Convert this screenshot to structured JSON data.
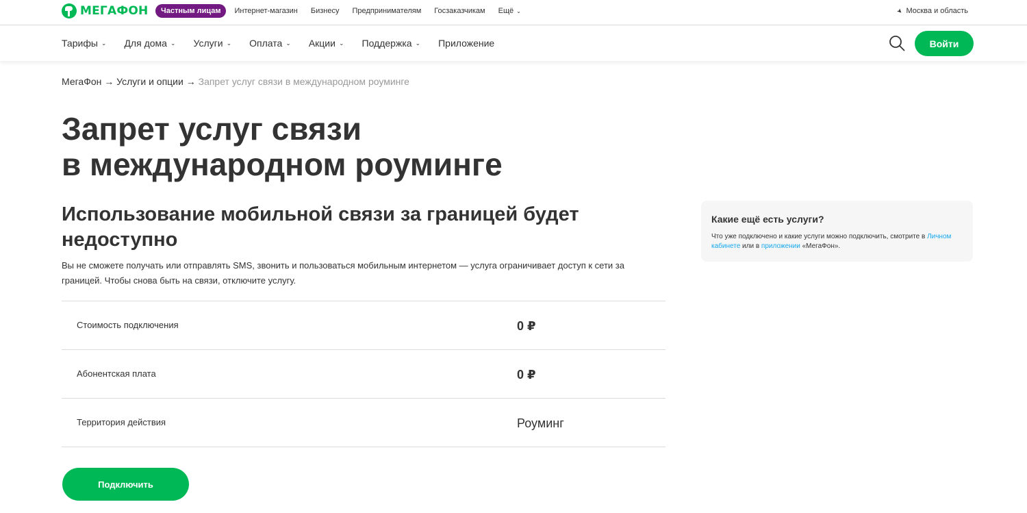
{
  "brand": {
    "logo_text": "МЕГАФОН",
    "accent": "#00b956",
    "segment_accent": "#731982"
  },
  "top_segments": [
    {
      "label": "Частным лицам",
      "active": true
    },
    {
      "label": "Интернет-магазин"
    },
    {
      "label": "Бизнесу"
    },
    {
      "label": "Предпринимателям"
    },
    {
      "label": "Госзаказчикам"
    },
    {
      "label": "Ещё"
    }
  ],
  "region": {
    "label": "Москва и область",
    "icon": "location-arrow-icon"
  },
  "main_menu": [
    {
      "label": "Тарифы",
      "dropdown": true
    },
    {
      "label": "Для дома",
      "dropdown": true
    },
    {
      "label": "Услуги",
      "dropdown": true
    },
    {
      "label": "Оплата",
      "dropdown": true
    },
    {
      "label": "Акции",
      "dropdown": true
    },
    {
      "label": "Поддержка",
      "dropdown": true
    },
    {
      "label": "Приложение",
      "dropdown": false
    }
  ],
  "search": {
    "icon": "search-icon"
  },
  "login_label": "Войти",
  "breadcrumb": {
    "items": [
      "МегаФон",
      "Услуги и опции"
    ],
    "separator": "→",
    "current": "Запрет услуг связи в международном роуминге"
  },
  "title": {
    "line1": "Запрет услуг связи",
    "line2": "в международном роуминге"
  },
  "subtitle": "Использование мобильной связи за границей будет недоступно",
  "description": "Вы не сможете получать или отправлять SMS, звонить и пользоваться мобильным интернетом — услуга ограничивает доступ к сети за границей. Чтобы снова быть на связи, отключите услугу.",
  "info_rows": [
    {
      "label": "Стоимость подключения",
      "value": "0 ₽"
    },
    {
      "label": "Абонентская плата",
      "value": "0 ₽"
    },
    {
      "label": "Территория действия",
      "value": "Роуминг"
    }
  ],
  "connect_label": "Подключить",
  "side_card": {
    "title": "Какие ещё есть услуги?",
    "text_before": "Что уже подключено и какие услуги можно подключить, смотрите в ",
    "link1": "Личном кабинете",
    "text_middle": " или в ",
    "link2": "приложении",
    "text_after": " «МегаФон».",
    "link_color": "#15a8ee"
  }
}
